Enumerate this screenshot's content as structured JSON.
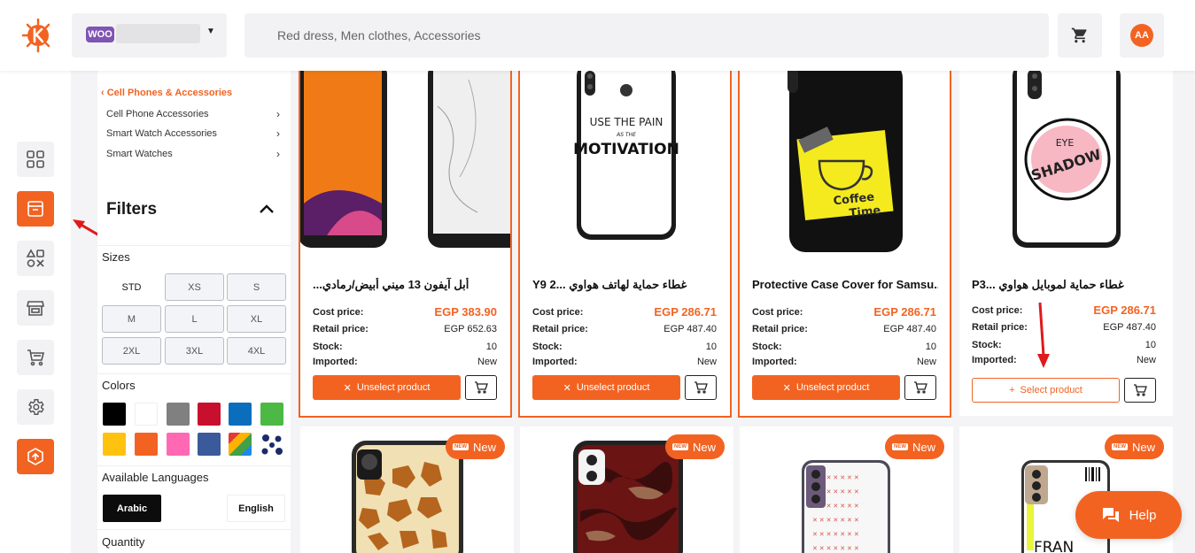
{
  "header": {
    "store_badge": "WOO",
    "search_placeholder": "Red dress, Men clothes, Accessories",
    "avatar_initials": "AA"
  },
  "rail": {
    "items": [
      "dashboard-grid-icon",
      "products-box-icon",
      "categories-icon",
      "store-icon",
      "cart-icon",
      "settings-gear-icon",
      "upgrade-icon"
    ],
    "active_index": 1
  },
  "filters": {
    "breadcrumb": "Cell Phones & Accessories",
    "subcategories": [
      "Cell Phone Accessories",
      "Smart Watch Accessories",
      "Smart Watches"
    ],
    "title": "Filters",
    "sizes_label": "Sizes",
    "sizes": [
      "STD",
      "XS",
      "S",
      "M",
      "L",
      "XL",
      "2XL",
      "3XL",
      "4XL"
    ],
    "colors_label": "Colors",
    "colors": [
      "#000000",
      "#ffffff",
      "#808080",
      "#c8102e",
      "#0b6ebd",
      "#4cb944",
      "#ffc20e",
      "#f26322",
      "#ff69b4",
      "#3a5a9b",
      "multicolor",
      "pattern"
    ],
    "languages_label": "Available Languages",
    "languages": [
      "Arabic",
      "English"
    ],
    "quantity_label": "Quantity"
  },
  "labels": {
    "cost": "Cost price:",
    "retail": "Retail price:",
    "stock": "Stock:",
    "imported": "Imported:",
    "unselect": "Unselect product",
    "select": "Select product",
    "new_badge": "New",
    "new_tag": "NEW",
    "help": "Help"
  },
  "products": [
    {
      "title": "...أبل آيفون 13 ميني أبيض/رمادي",
      "cost": "EGP 383.90",
      "retail": "EGP 652.63",
      "stock": "10",
      "imported": "New",
      "selected": true
    },
    {
      "title": "Y9 2... غطاء حماية لهاتف هواوي",
      "cost": "EGP 286.71",
      "retail": "EGP 487.40",
      "stock": "10",
      "imported": "New",
      "selected": true
    },
    {
      "title": "Protective Case Cover for Samsu...",
      "cost": "EGP 286.71",
      "retail": "EGP 487.40",
      "stock": "10",
      "imported": "New",
      "selected": true
    },
    {
      "title": "P3... غطاء حماية لموبايل هواوي",
      "cost": "EGP 286.71",
      "retail": "EGP 487.40",
      "stock": "10",
      "imported": "New",
      "selected": false
    }
  ],
  "case_prints": {
    "motivation_line1": "USE THE PAIN",
    "motivation_line2": "AS THE",
    "motivation_line3": "MOTIVATION",
    "coffee_line1": "Coffee",
    "coffee_line2": "Time",
    "eyeshadow_line1": "EYE",
    "eyeshadow_line2": "SHADOW",
    "fran": "FRAN"
  }
}
